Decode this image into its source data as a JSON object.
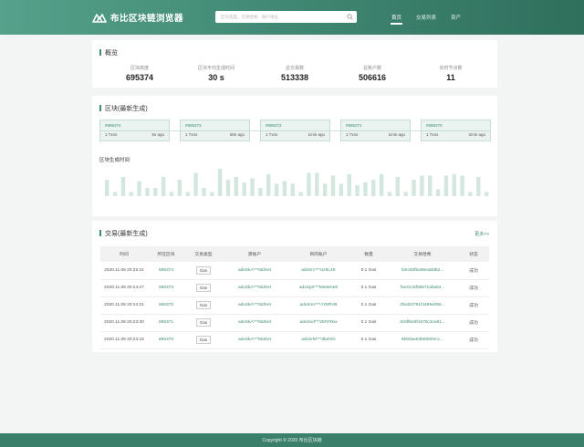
{
  "header": {
    "site_title": "布比区块链浏览器",
    "search_placeholder": "区块高度、交易哈希、账户地址",
    "nav": [
      "首页",
      "交易列表",
      "资产"
    ],
    "active_nav": "首页",
    "accent_color": "#3f8c72"
  },
  "overview": {
    "title": "概览",
    "stats": [
      {
        "label": "区块高度",
        "value": "695374"
      },
      {
        "label": "区块平均生成时间",
        "value": "30 s"
      },
      {
        "label": "总交易数",
        "value": "513338"
      },
      {
        "label": "总账户数",
        "value": "506616"
      },
      {
        "label": "实时节点数",
        "value": "11"
      }
    ]
  },
  "blocks": {
    "title": "区块(最新生成)",
    "items": [
      {
        "height": "#695374",
        "txs": "1 Txns",
        "age": "6s ago"
      },
      {
        "height": "#695373",
        "txs": "1 Txns",
        "age": "60s ago"
      },
      {
        "height": "#695372",
        "txs": "1 Txns",
        "age": "1min ago"
      },
      {
        "height": "#695371",
        "txs": "1 Txns",
        "age": "1min ago"
      },
      {
        "height": "#695370",
        "txs": "1 Txns",
        "age": "2min ago"
      }
    ],
    "chart_title": "区块生成时间"
  },
  "chart_data": {
    "type": "bar",
    "title": "区块生成时间",
    "xlabel": "",
    "ylabel": "",
    "grid": false,
    "bar_color": "#d3e7df",
    "values": [
      12,
      3,
      14,
      3,
      11,
      6,
      6,
      14,
      3,
      12,
      3,
      17,
      6,
      3,
      20,
      12,
      14,
      10,
      13,
      6,
      16,
      9,
      11,
      9,
      3,
      17,
      17,
      9,
      15,
      9,
      16,
      8,
      10,
      12,
      16,
      3,
      14,
      3,
      12,
      15,
      15,
      5,
      15,
      16,
      15,
      3,
      14,
      3
    ]
  },
  "transactions": {
    "title": "交易(最新生成)",
    "more_label": "更多>>",
    "columns": [
      "时间",
      "所在区块",
      "交易类型",
      "源账户",
      "目的账户",
      "数量",
      "交易哈希",
      "状态"
    ],
    "rows": [
      [
        "2020.11.08 20:25:21",
        "695374",
        "Gas",
        "adxSkA***5tdXet",
        "adxSrc***Uz6L4K",
        "0.1 Gas",
        "f2ec82fba96eddd62...",
        "成功"
      ],
      [
        "2020.11.08 20:24:27",
        "695373",
        "Gas",
        "adxSkA***5tdXet",
        "adxSp2***MwWAe8",
        "0.1 Gas",
        "f1e31c5f08671aba54...",
        "成功"
      ],
      [
        "2020.11.08 20:24:21",
        "695372",
        "Gas",
        "adxSkA***5tdXet",
        "adxSmz***JY9RVB",
        "0.1 Gas",
        "2fed23791f4489e055...",
        "成功"
      ],
      [
        "2020.11.08 20:23:30",
        "695371",
        "Gas",
        "adxSkA***5tdXet",
        "adxSed***2MYRkw",
        "0.1 Gas",
        "3c5ff6e5f1870c3ce81...",
        "成功"
      ],
      [
        "2020.11.08 20:23:18",
        "695370",
        "Gas",
        "adxSkA***5tdXet",
        "adxSrM***dbehiG",
        "0.1 Gas",
        "5b93ae63b8060ecc...",
        "成功"
      ]
    ]
  },
  "footer": {
    "copyright": "Copyright © 2020 布比区块链"
  }
}
